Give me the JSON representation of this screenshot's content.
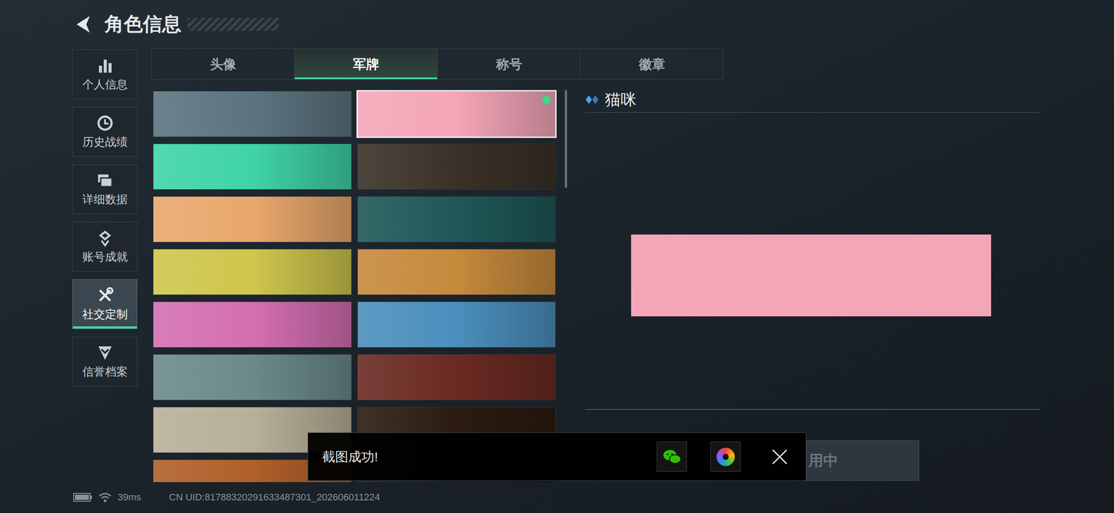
{
  "header": {
    "title": "角色信息"
  },
  "sidebar": {
    "items": [
      {
        "label": "个人信息",
        "selected": false
      },
      {
        "label": "历史战绩",
        "selected": false
      },
      {
        "label": "详细数据",
        "selected": false
      },
      {
        "label": "账号成就",
        "selected": false
      },
      {
        "label": "社交定制",
        "selected": true
      },
      {
        "label": "信誉档案",
        "selected": false
      }
    ]
  },
  "tabs": [
    {
      "label": "头像",
      "selected": false
    },
    {
      "label": "军牌",
      "selected": true
    },
    {
      "label": "称号",
      "selected": false
    },
    {
      "label": "徽章",
      "selected": false
    }
  ],
  "cards": [
    {
      "color": "#5c7480",
      "selected": false,
      "equipped": false
    },
    {
      "color": "#f4a6b8",
      "selected": true,
      "equipped": true
    },
    {
      "color": "#3fd4a6",
      "selected": false,
      "equipped": false
    },
    {
      "color": "#3a3128",
      "selected": false,
      "equipped": false
    },
    {
      "color": "#e9a86c",
      "selected": false,
      "equipped": false
    },
    {
      "color": "#1e5857",
      "selected": false,
      "equipped": false
    },
    {
      "color": "#cfc64c",
      "selected": false,
      "equipped": false
    },
    {
      "color": "#c68a3c",
      "selected": false,
      "equipped": false
    },
    {
      "color": "#d46fb2",
      "selected": false,
      "equipped": false
    },
    {
      "color": "#4b8fbd",
      "selected": false,
      "equipped": false
    },
    {
      "color": "#6b8a8c",
      "selected": false,
      "equipped": false
    },
    {
      "color": "#6a2a22",
      "selected": false,
      "equipped": false
    },
    {
      "color": "#b8b098",
      "selected": false,
      "equipped": false
    },
    {
      "color": "#2b1b10",
      "selected": false,
      "equipped": false
    },
    {
      "color": "#b0602a",
      "selected": false,
      "equipped": false
    },
    {
      "color": "#1a1a1a",
      "selected": false,
      "equipped": false
    }
  ],
  "detail": {
    "title": "猫咪",
    "color": "#f4a6b8"
  },
  "use_button": {
    "label": "用中",
    "disabled": true
  },
  "toast": {
    "message": "截图成功!"
  },
  "status_bar": {
    "ping": "39ms",
    "uid": "CN UID:81788320291633487301_202606011224"
  }
}
